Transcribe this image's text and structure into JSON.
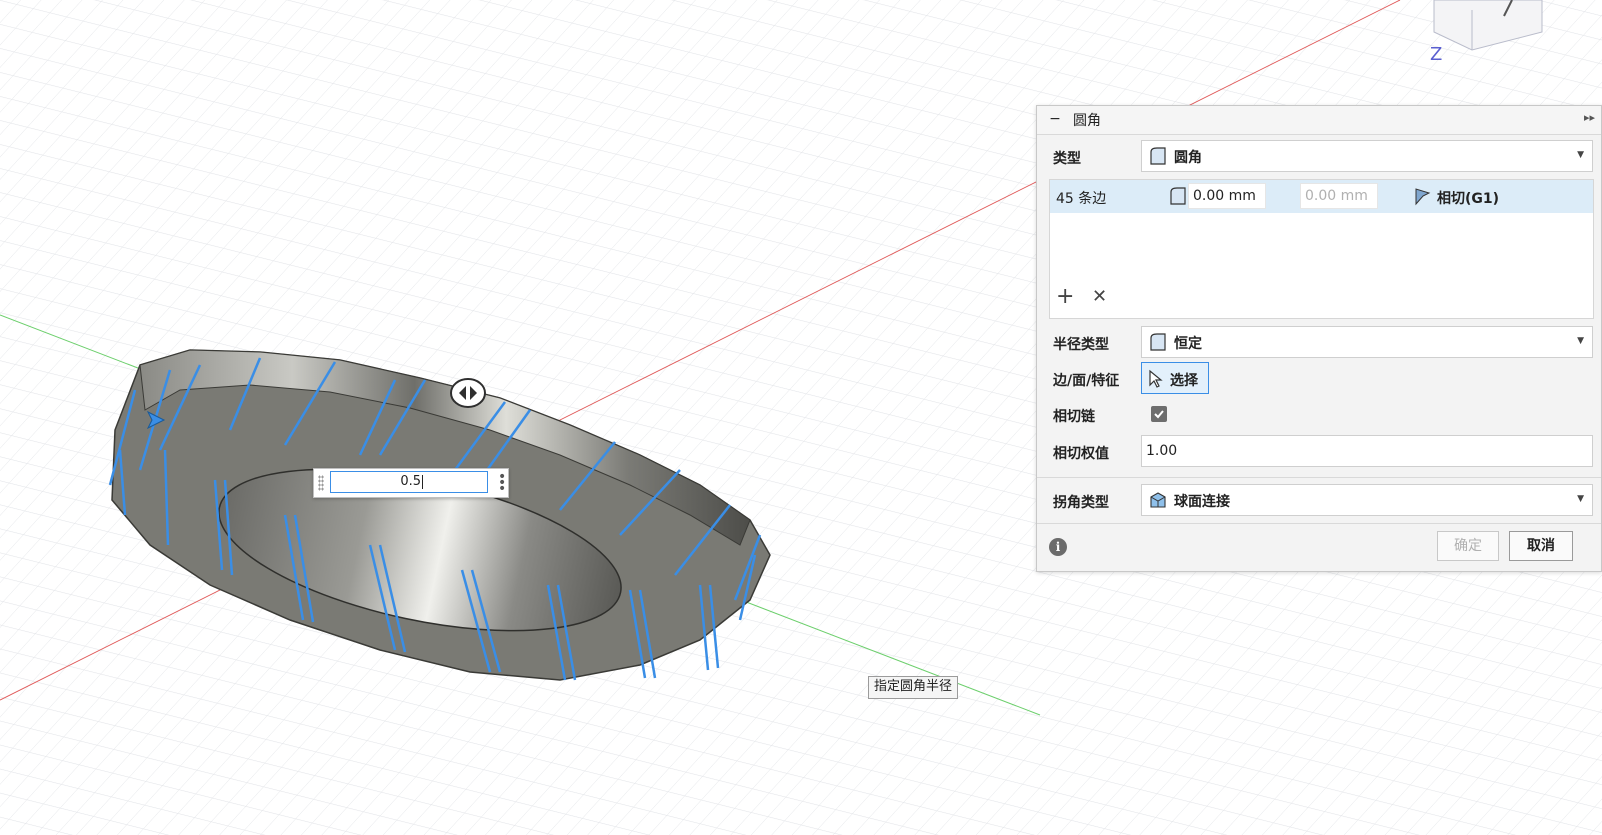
{
  "viewcube": {
    "axis_label": "Z"
  },
  "radius_input": {
    "value": "0.5"
  },
  "tooltip": {
    "text": "指定圆角半径"
  },
  "panel": {
    "title": "圆角",
    "type": {
      "label": "类型",
      "value": "圆角"
    },
    "edge_set": {
      "count": "45 条边",
      "radius": "0.00 mm",
      "radius_secondary": "0.00 mm",
      "continuity": "相切(G1)"
    },
    "radius_type": {
      "label": "半径类型",
      "value": "恒定"
    },
    "selection": {
      "label": "边/面/特征",
      "button": "选择"
    },
    "tangent_chain": {
      "label": "相切链",
      "checked": true
    },
    "tangent_weight": {
      "label": "相切权值",
      "value": "1.00"
    },
    "corner_type": {
      "label": "拐角类型",
      "value": "球面连接"
    },
    "buttons": {
      "ok": "确定",
      "cancel": "取消"
    }
  },
  "colors": {
    "accent": "#3a8ee6",
    "highlight_edges": "#3a8ee6",
    "axis_red": "#e05a5a",
    "axis_green": "#6ccf6c"
  }
}
